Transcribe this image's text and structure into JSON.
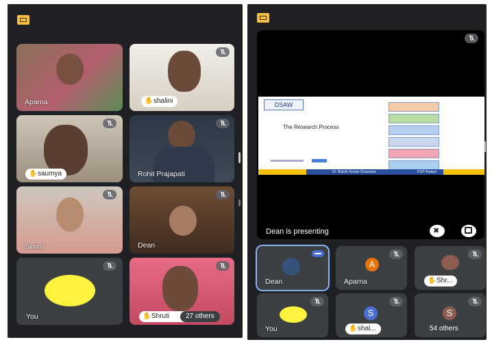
{
  "left": {
    "tiles": [
      {
        "name": "Aparna"
      },
      {
        "name": "shalini"
      },
      {
        "name": "saumya"
      },
      {
        "name": "Rohit Prajapati"
      },
      {
        "name": "Simmi"
      },
      {
        "name": "Dean"
      },
      {
        "name": "You"
      },
      {
        "name": "Shruti",
        "others": "27 others"
      }
    ]
  },
  "right": {
    "presenting": "Dean is presenting",
    "slide": {
      "badge": "DSAW",
      "title": "The Research Process",
      "footer_left": "Dr. Brijesh Kumar Chaurasia",
      "footer_right": "PSIT-Kanpur"
    },
    "tiles": [
      {
        "name": "Dean"
      },
      {
        "name": "Aparna",
        "initial": "A"
      },
      {
        "name": "Shr..."
      },
      {
        "name": "You"
      },
      {
        "name": "shal...",
        "initial": "S"
      },
      {
        "initial": "S",
        "others": "54 others"
      }
    ],
    "colors": {
      "aparna": "#e8710a",
      "shal": "#4a6fd4",
      "s3": "#8d5d4f",
      "yellow": "#fff33f",
      "accent": "#8ab4f8"
    }
  }
}
